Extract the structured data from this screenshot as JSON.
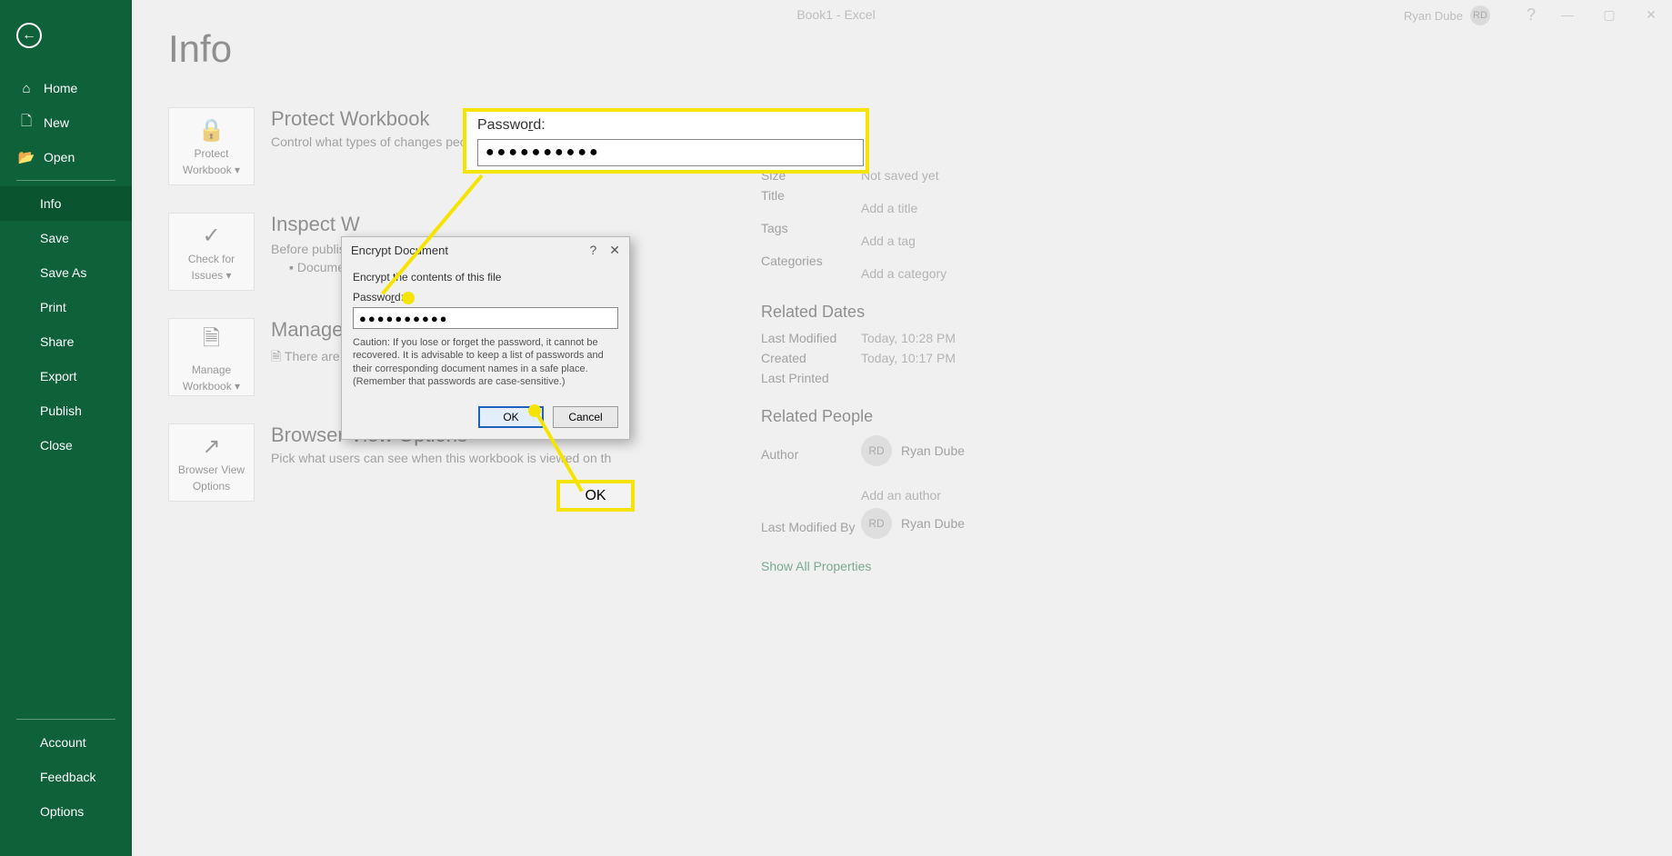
{
  "titlebar": {
    "title": "Book1 - Excel",
    "user": "Ryan Dube",
    "user_initials": "RD"
  },
  "sidebar": {
    "back_glyph": "←",
    "top_items": [
      {
        "icon": "⌂",
        "label": "Home"
      },
      {
        "icon": "🗋",
        "label": "New"
      },
      {
        "icon": "📂",
        "label": "Open"
      }
    ],
    "mid_items": [
      {
        "label": "Info",
        "selected": true
      },
      {
        "label": "Save"
      },
      {
        "label": "Save As"
      },
      {
        "label": "Print"
      },
      {
        "label": "Share"
      },
      {
        "label": "Export"
      },
      {
        "label": "Publish"
      },
      {
        "label": "Close"
      }
    ],
    "foot_items": [
      {
        "label": "Account"
      },
      {
        "label": "Feedback"
      },
      {
        "label": "Options"
      }
    ]
  },
  "page": {
    "title": "Info"
  },
  "sections": {
    "protect": {
      "btn1": "Protect",
      "btn2": "Workbook ▾",
      "heading": "Protect Workbook",
      "desc": "Control what types of changes people can make to this workbook."
    },
    "inspect": {
      "btn1": "Check for",
      "btn2": "Issues ▾",
      "heading": "Inspect W",
      "desc": "Before publishi",
      "bullet": "Document"
    },
    "manage": {
      "btn1": "Manage",
      "btn2": "Workbook ▾",
      "heading": "Manage W",
      "desc": "There are "
    },
    "browser": {
      "btn1": "Browser View",
      "btn2": "Options",
      "heading": "Browser View Options",
      "desc": "Pick what users can see when this workbook is viewed on th"
    }
  },
  "properties": {
    "size_label": "Size",
    "size_value": "Not saved yet",
    "title_label": "Title",
    "title_value": "Add a title",
    "tags_label": "Tags",
    "tags_value": "Add a tag",
    "categories_label": "Categories",
    "categories_value": "Add a category",
    "related_dates": "Related Dates",
    "lastmod_label": "Last Modified",
    "lastmod_value": "Today, 10:28 PM",
    "created_label": "Created",
    "created_value": "Today, 10:17 PM",
    "lastprint_label": "Last Printed",
    "lastprint_value": "",
    "related_people": "Related People",
    "author_label": "Author",
    "author_name": "Ryan Dube",
    "author_initials": "RD",
    "add_author": "Add an author",
    "lastmodby_label": "Last Modified By",
    "lastmodby_name": "Ryan Dube",
    "lastmodby_initials": "RD",
    "show_all": "Show All Properties"
  },
  "dialog": {
    "title": "Encrypt Document",
    "help": "?",
    "close": "✕",
    "instruction": "Encrypt the contents of this file",
    "pw_label1": "Passwo",
    "pw_label_u": "r",
    "pw_label2": "d:",
    "pw_value": "●●●●●●●●●●",
    "caution": "Caution: If you lose or forget the password, it cannot be recovered. It is advisable to keep a list of passwords and their corresponding document names in a safe place. (Remember that passwords are case-sensitive.)",
    "ok": "OK",
    "cancel": "Cancel"
  },
  "callouts": {
    "pw_label1": "Passwo",
    "pw_label_u": "r",
    "pw_label2": "d:",
    "pw_value": "●●●●●●●●●●",
    "ok": "OK"
  }
}
